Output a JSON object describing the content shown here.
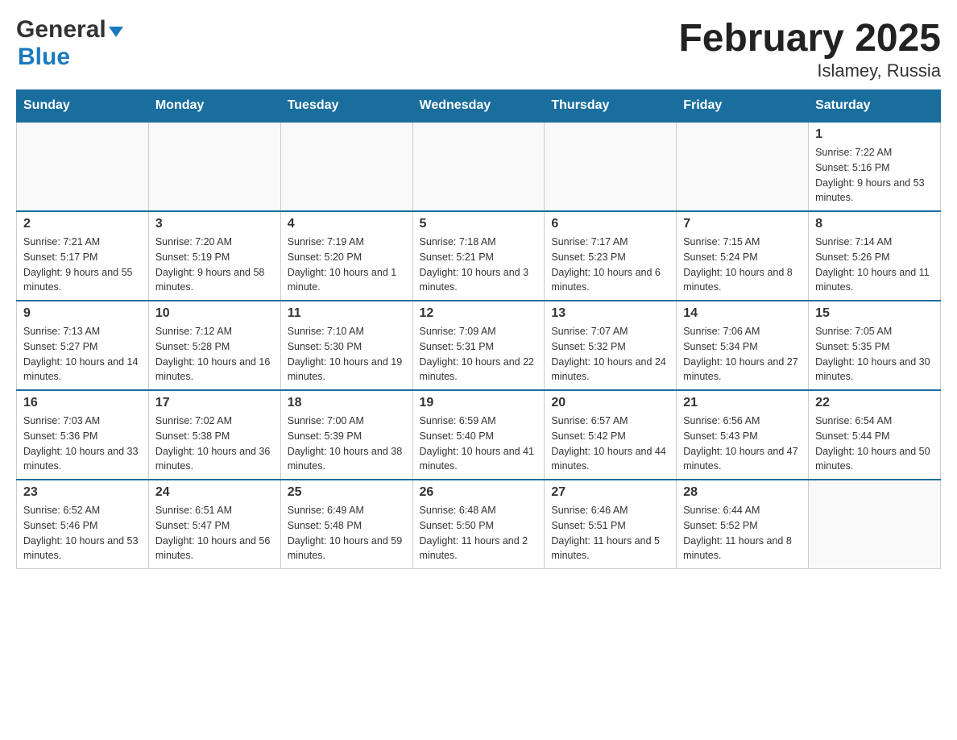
{
  "header": {
    "logo_general": "General",
    "logo_blue": "Blue",
    "title": "February 2025",
    "subtitle": "Islamey, Russia"
  },
  "calendar": {
    "days_of_week": [
      "Sunday",
      "Monday",
      "Tuesday",
      "Wednesday",
      "Thursday",
      "Friday",
      "Saturday"
    ],
    "weeks": [
      {
        "days": [
          {
            "number": "",
            "info": ""
          },
          {
            "number": "",
            "info": ""
          },
          {
            "number": "",
            "info": ""
          },
          {
            "number": "",
            "info": ""
          },
          {
            "number": "",
            "info": ""
          },
          {
            "number": "",
            "info": ""
          },
          {
            "number": "1",
            "info": "Sunrise: 7:22 AM\nSunset: 5:16 PM\nDaylight: 9 hours and 53 minutes."
          }
        ]
      },
      {
        "days": [
          {
            "number": "2",
            "info": "Sunrise: 7:21 AM\nSunset: 5:17 PM\nDaylight: 9 hours and 55 minutes."
          },
          {
            "number": "3",
            "info": "Sunrise: 7:20 AM\nSunset: 5:19 PM\nDaylight: 9 hours and 58 minutes."
          },
          {
            "number": "4",
            "info": "Sunrise: 7:19 AM\nSunset: 5:20 PM\nDaylight: 10 hours and 1 minute."
          },
          {
            "number": "5",
            "info": "Sunrise: 7:18 AM\nSunset: 5:21 PM\nDaylight: 10 hours and 3 minutes."
          },
          {
            "number": "6",
            "info": "Sunrise: 7:17 AM\nSunset: 5:23 PM\nDaylight: 10 hours and 6 minutes."
          },
          {
            "number": "7",
            "info": "Sunrise: 7:15 AM\nSunset: 5:24 PM\nDaylight: 10 hours and 8 minutes."
          },
          {
            "number": "8",
            "info": "Sunrise: 7:14 AM\nSunset: 5:26 PM\nDaylight: 10 hours and 11 minutes."
          }
        ]
      },
      {
        "days": [
          {
            "number": "9",
            "info": "Sunrise: 7:13 AM\nSunset: 5:27 PM\nDaylight: 10 hours and 14 minutes."
          },
          {
            "number": "10",
            "info": "Sunrise: 7:12 AM\nSunset: 5:28 PM\nDaylight: 10 hours and 16 minutes."
          },
          {
            "number": "11",
            "info": "Sunrise: 7:10 AM\nSunset: 5:30 PM\nDaylight: 10 hours and 19 minutes."
          },
          {
            "number": "12",
            "info": "Sunrise: 7:09 AM\nSunset: 5:31 PM\nDaylight: 10 hours and 22 minutes."
          },
          {
            "number": "13",
            "info": "Sunrise: 7:07 AM\nSunset: 5:32 PM\nDaylight: 10 hours and 24 minutes."
          },
          {
            "number": "14",
            "info": "Sunrise: 7:06 AM\nSunset: 5:34 PM\nDaylight: 10 hours and 27 minutes."
          },
          {
            "number": "15",
            "info": "Sunrise: 7:05 AM\nSunset: 5:35 PM\nDaylight: 10 hours and 30 minutes."
          }
        ]
      },
      {
        "days": [
          {
            "number": "16",
            "info": "Sunrise: 7:03 AM\nSunset: 5:36 PM\nDaylight: 10 hours and 33 minutes."
          },
          {
            "number": "17",
            "info": "Sunrise: 7:02 AM\nSunset: 5:38 PM\nDaylight: 10 hours and 36 minutes."
          },
          {
            "number": "18",
            "info": "Sunrise: 7:00 AM\nSunset: 5:39 PM\nDaylight: 10 hours and 38 minutes."
          },
          {
            "number": "19",
            "info": "Sunrise: 6:59 AM\nSunset: 5:40 PM\nDaylight: 10 hours and 41 minutes."
          },
          {
            "number": "20",
            "info": "Sunrise: 6:57 AM\nSunset: 5:42 PM\nDaylight: 10 hours and 44 minutes."
          },
          {
            "number": "21",
            "info": "Sunrise: 6:56 AM\nSunset: 5:43 PM\nDaylight: 10 hours and 47 minutes."
          },
          {
            "number": "22",
            "info": "Sunrise: 6:54 AM\nSunset: 5:44 PM\nDaylight: 10 hours and 50 minutes."
          }
        ]
      },
      {
        "days": [
          {
            "number": "23",
            "info": "Sunrise: 6:52 AM\nSunset: 5:46 PM\nDaylight: 10 hours and 53 minutes."
          },
          {
            "number": "24",
            "info": "Sunrise: 6:51 AM\nSunset: 5:47 PM\nDaylight: 10 hours and 56 minutes."
          },
          {
            "number": "25",
            "info": "Sunrise: 6:49 AM\nSunset: 5:48 PM\nDaylight: 10 hours and 59 minutes."
          },
          {
            "number": "26",
            "info": "Sunrise: 6:48 AM\nSunset: 5:50 PM\nDaylight: 11 hours and 2 minutes."
          },
          {
            "number": "27",
            "info": "Sunrise: 6:46 AM\nSunset: 5:51 PM\nDaylight: 11 hours and 5 minutes."
          },
          {
            "number": "28",
            "info": "Sunrise: 6:44 AM\nSunset: 5:52 PM\nDaylight: 11 hours and 8 minutes."
          },
          {
            "number": "",
            "info": ""
          }
        ]
      }
    ]
  }
}
